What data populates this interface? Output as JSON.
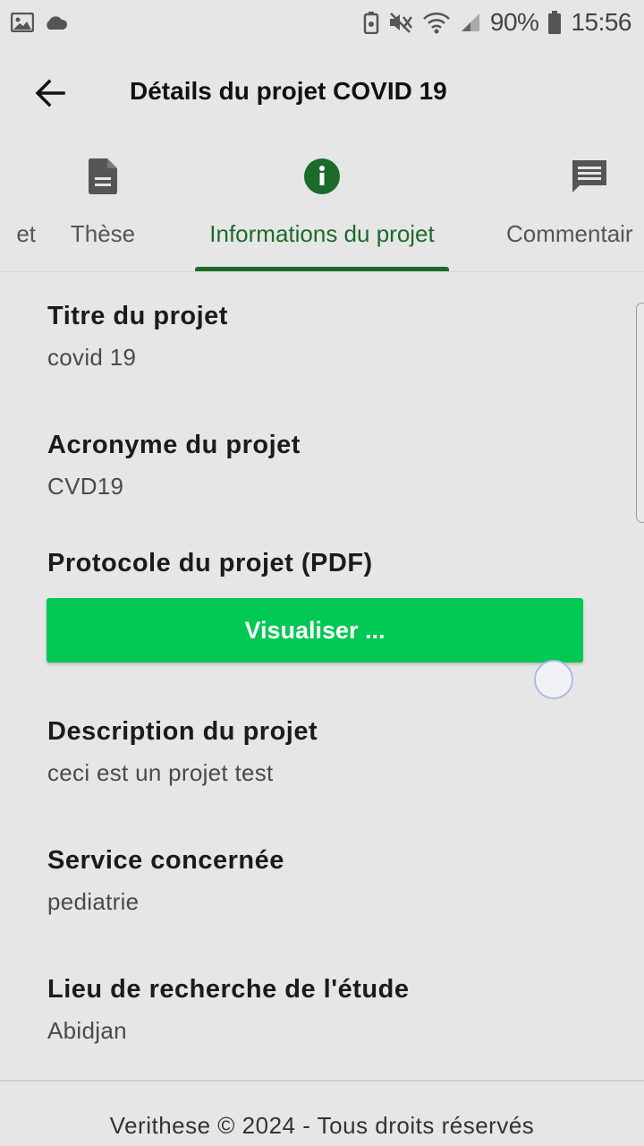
{
  "status_bar": {
    "battery_percent": "90%",
    "time": "15:56"
  },
  "header": {
    "title": "Détails du projet COVID 19"
  },
  "tabs": [
    {
      "label": "et",
      "icon": "document-icon"
    },
    {
      "label": "Thèse",
      "icon": "document-icon"
    },
    {
      "label": "Informations du projet",
      "icon": "info-icon",
      "active": true
    },
    {
      "label": "Commentair",
      "icon": "comment-icon"
    }
  ],
  "fields": {
    "title": {
      "label": "Titre du projet",
      "value": "covid 19"
    },
    "acronym": {
      "label": "Acronyme du projet",
      "value": "CVD19"
    },
    "protocol": {
      "label": "Protocole du projet (PDF)",
      "button": "Visualiser ..."
    },
    "description": {
      "label": "Description du projet",
      "value": "ceci est un projet test"
    },
    "service": {
      "label": "Service concernée",
      "value": "pediatrie"
    },
    "location": {
      "label": "Lieu de recherche de l'étude",
      "value": "Abidjan"
    }
  },
  "footer": {
    "text": "Verithese © 2024 - Tous droits réservés"
  },
  "colors": {
    "accent": "#1b6b2a",
    "button": "#00c853",
    "background": "#e6e6e6"
  }
}
